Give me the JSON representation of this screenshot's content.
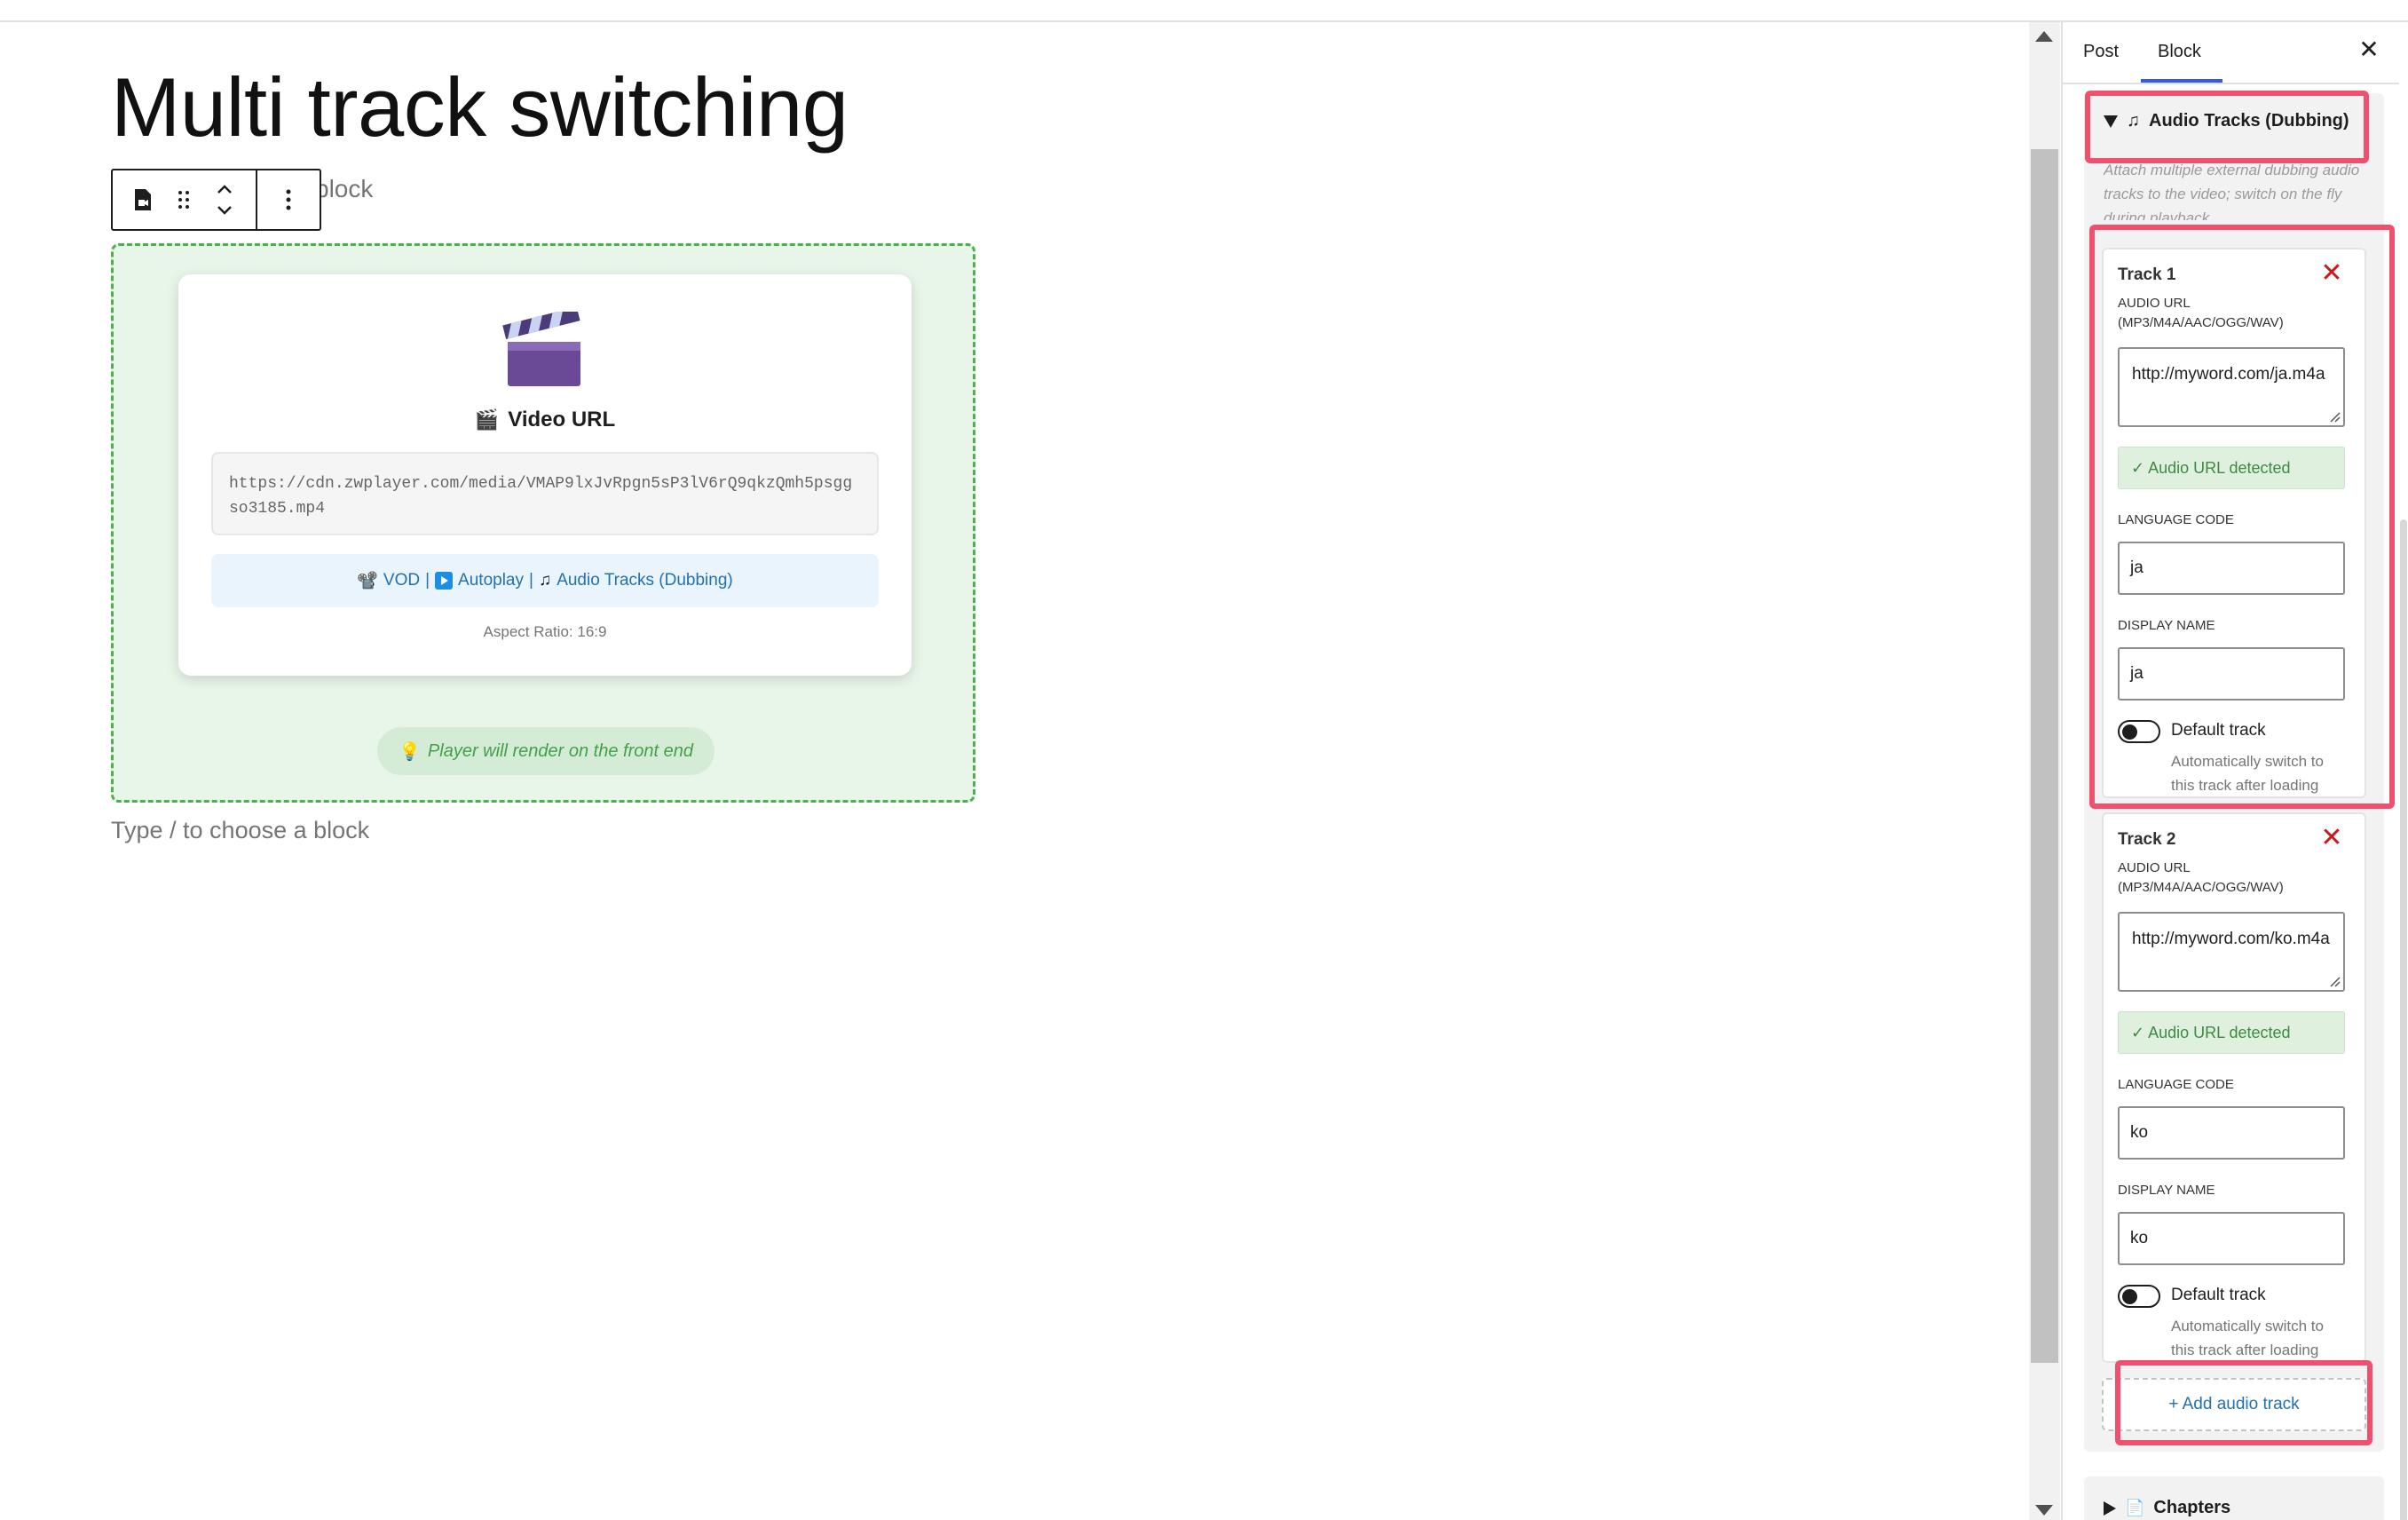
{
  "editor": {
    "post_title": "Multi track switching",
    "appender_fragment": "block",
    "type_hint": "Type / to choose a block"
  },
  "zwblock": {
    "video_title_icon": "clapper-board-icon",
    "video_title": "Video URL",
    "video_url": "https://cdn.zwplayer.com/media/VMAP9lxJvRpgn5sP3lV6rQ9qkzQmh5psggso3185.mp4",
    "features": {
      "vod": "VOD",
      "sep": "|",
      "autoplay": "Autoplay",
      "audio_tracks": "Audio Tracks (Dubbing)"
    },
    "aspect_ratio": "Aspect Ratio: 16:9",
    "render_note": "Player will render on the front end"
  },
  "sidebar": {
    "tabs": [
      {
        "label": "Post",
        "active": false
      },
      {
        "label": "Block",
        "active": true
      }
    ],
    "close_glyph": "✕",
    "panel": {
      "title": "Audio Tracks (Dubbing)",
      "description": "Attach multiple external dubbing audio tracks to the video; switch on the fly during playback."
    },
    "labels": {
      "audio_url": "AUDIO URL (MP3/M4A/AAC/OGG/WAV)",
      "detected": "✓ Audio URL detected",
      "language_code": "LANGUAGE CODE",
      "display_name": "DISPLAY NAME",
      "default_track": "Default track",
      "default_help": "Automatically switch to this track after loading"
    },
    "tracks": [
      {
        "title": "Track 1",
        "audio_url": "http://myword.com/ja.m4a",
        "language_code": "ja",
        "display_name": "ja",
        "default": false
      },
      {
        "title": "Track 2",
        "audio_url": "http://myword.com/ko.m4a",
        "language_code": "ko",
        "display_name": "ko",
        "default": false
      }
    ],
    "add_track": "+ Add audio track",
    "chapters_title": "Chapters"
  },
  "colors": {
    "accent_blue": "#3858e9",
    "link_blue": "#2271b1",
    "success_green": "#4caf50",
    "danger_red": "#cc1818",
    "highlight": "#f0506e"
  }
}
